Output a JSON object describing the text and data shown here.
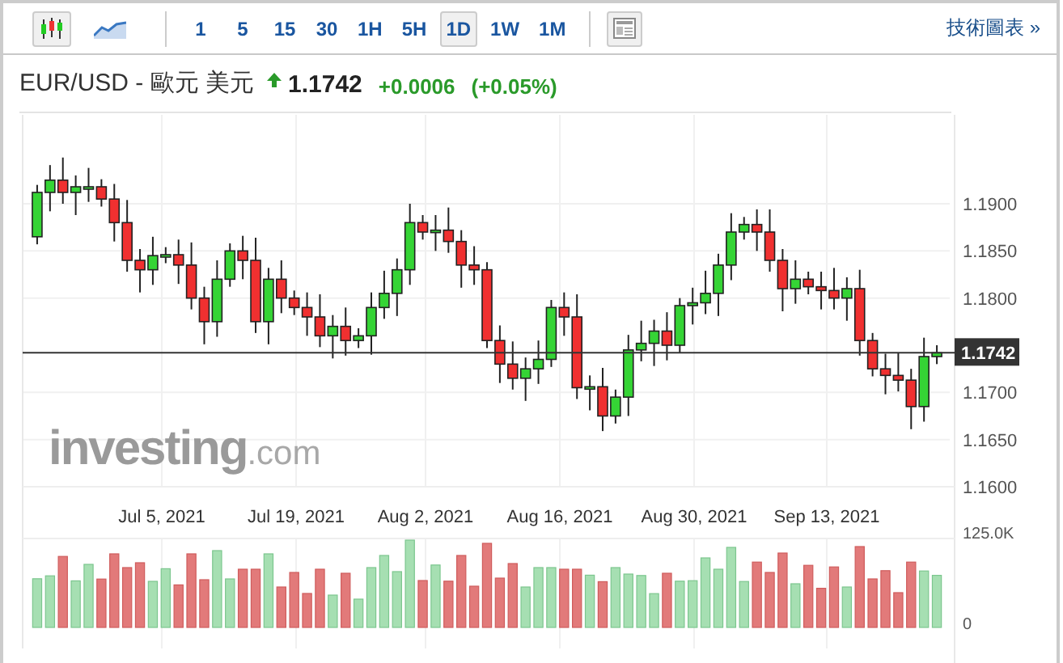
{
  "toolbar": {
    "chart_types": [
      {
        "kind": "candlestick",
        "selected": true
      },
      {
        "kind": "line",
        "selected": false
      }
    ],
    "intervals": [
      {
        "label": "1",
        "selected": false
      },
      {
        "label": "5",
        "selected": false
      },
      {
        "label": "15",
        "selected": false
      },
      {
        "label": "30",
        "selected": false
      },
      {
        "label": "1H",
        "selected": false
      },
      {
        "label": "5H",
        "selected": false
      },
      {
        "label": "1D",
        "selected": true
      },
      {
        "label": "1W",
        "selected": false
      },
      {
        "label": "1M",
        "selected": false
      }
    ],
    "link": "技術圖表 »"
  },
  "quote": {
    "symbol": "EUR/USD - 歐元 美元",
    "change_positive": true,
    "price": "1.1742",
    "change": "+0.0006",
    "change_percent": "(+0.05%)"
  },
  "chart": {
    "yticks": [
      "1.1900",
      "1.1850",
      "1.1800",
      "1.1700",
      "1.1650",
      "1.1600"
    ],
    "current_price": "1.1742",
    "xlabels": [
      "Jul 5, 2021",
      "Jul 19, 2021",
      "Aug 2, 2021",
      "Aug 16, 2021",
      "Aug 30, 2021",
      "Sep 13, 2021"
    ],
    "volume_ticks": [
      "125.0K",
      "0"
    ],
    "logo": {
      "name": "investing",
      "suffix": ".com"
    }
  }
}
